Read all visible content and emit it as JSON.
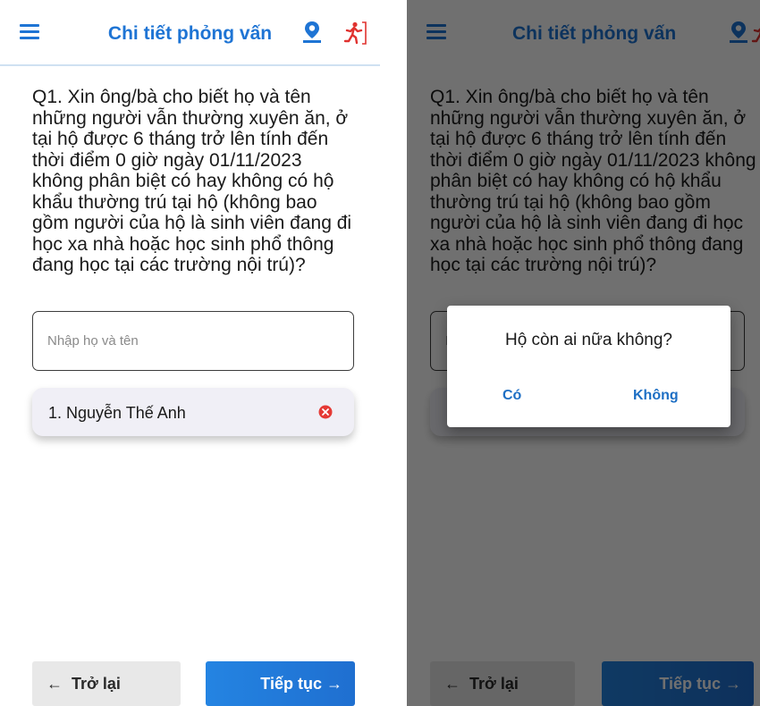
{
  "appbar": {
    "title": "Chi tiết phỏng vấn",
    "icons": [
      "menu-icon",
      "location-pin-icon",
      "exit-running-icon"
    ],
    "accent_color": "#1e74d4",
    "exit_color": "#e0322f"
  },
  "question": {
    "text": "Q1. Xin ông/bà cho biết họ và tên những người vẫn thường xuyên ăn, ở tại hộ được 6 tháng trở lên tính đến thời điểm 0 giờ ngày 01/11/2023 không phân biệt có hay không có hộ khẩu thường trú tại hộ (không bao gồm người của hộ là sinh viên đang đi học xa nhà hoặc học sinh phổ thông đang học tại các trường nội trú)?"
  },
  "name_input": {
    "placeholder": "Nhập họ và tên",
    "value": ""
  },
  "members": [
    {
      "label": "1. Nguyễn Thế Anh",
      "remove_icon": "remove-circle-icon",
      "remove_color": "#e53935"
    }
  ],
  "footer": {
    "back_label": "Trở lại",
    "back_arrow": "←",
    "next_label": "Tiếp tục",
    "next_arrow": "→"
  },
  "dialog": {
    "title": "Hộ còn ai nữa không?",
    "yes_label": "Có",
    "no_label": "Không",
    "button_color": "#1e6fc4"
  }
}
